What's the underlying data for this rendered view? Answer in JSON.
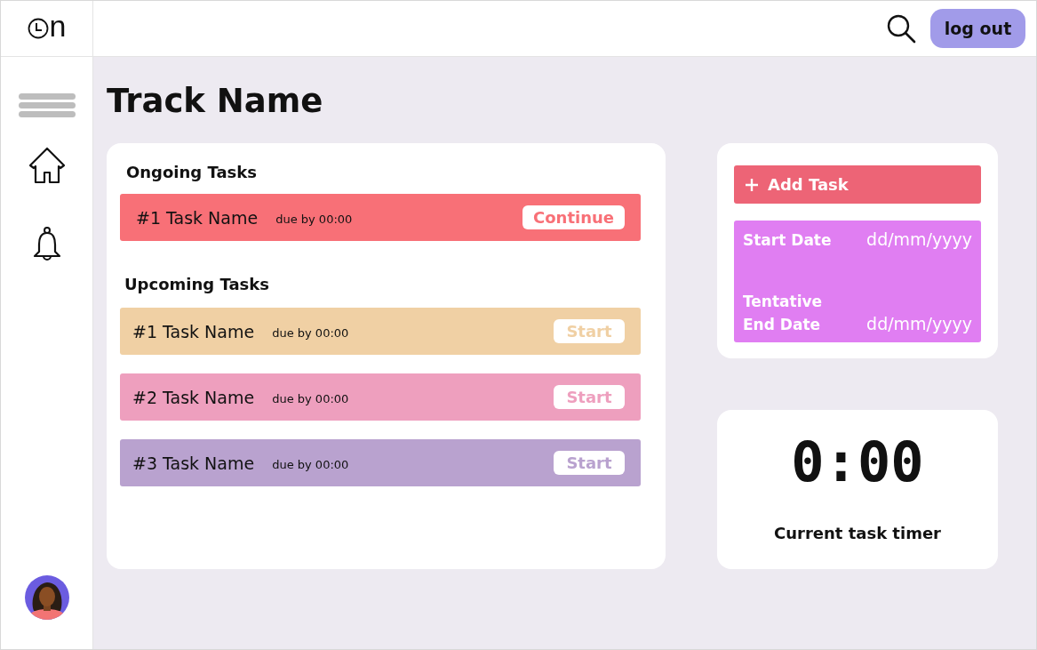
{
  "logo": {
    "text": "n"
  },
  "header": {
    "logout": "log out"
  },
  "page": {
    "title": "Track Name"
  },
  "ongoing": {
    "heading": "Ongoing Tasks",
    "tasks": [
      {
        "name": "#1 Task Name",
        "due": "due by 00:00",
        "action": "Continue",
        "color": "#f87077"
      }
    ]
  },
  "upcoming": {
    "heading": "Upcoming Tasks",
    "tasks": [
      {
        "name": "#1 Task Name",
        "due": "due by 00:00",
        "action": "Start",
        "color": "#f0d0a4"
      },
      {
        "name": "#2 Task Name",
        "due": "due by 00:00",
        "action": "Start",
        "color": "#ee9fbe"
      },
      {
        "name": "#3 Task Name",
        "due": "due by 00:00",
        "action": "Start",
        "color": "#b9a2cf"
      }
    ]
  },
  "add_task": {
    "label": "Add Task"
  },
  "dates": {
    "start_label": "Start Date",
    "start_value": "dd/mm/yyyy",
    "end_label_1": "Tentative",
    "end_label_2": "End Date",
    "end_value": "dd/mm/yyyy"
  },
  "timer": {
    "value": "0:00",
    "caption": "Current task timer"
  }
}
